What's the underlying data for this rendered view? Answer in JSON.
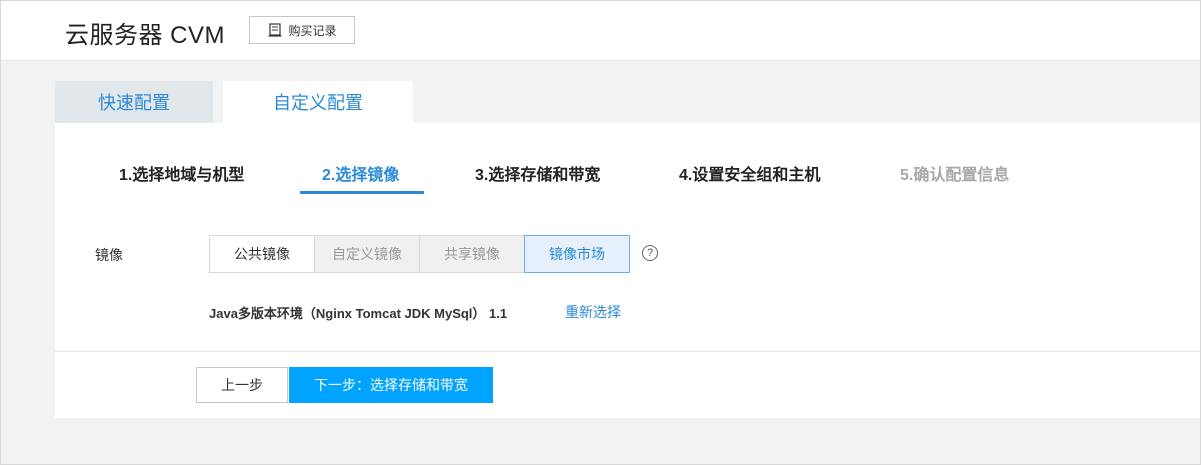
{
  "header": {
    "title": "云服务器 CVM",
    "purchase_record_label": "购买记录",
    "purchase_icon": "receipt-icon"
  },
  "tabs": [
    {
      "label": "快速配置",
      "active": false
    },
    {
      "label": "自定义配置",
      "active": true
    }
  ],
  "steps": [
    {
      "label": "1.选择地域与机型",
      "state": "done"
    },
    {
      "label": "2.选择镜像",
      "state": "active"
    },
    {
      "label": "3.选择存储和带宽",
      "state": "todo"
    },
    {
      "label": "4.设置安全组和主机",
      "state": "todo"
    },
    {
      "label": "5.确认配置信息",
      "state": "disabled"
    }
  ],
  "image_section": {
    "label": "镜像",
    "options": [
      {
        "label": "公共镜像",
        "state": "normal"
      },
      {
        "label": "自定义镜像",
        "state": "disabled"
      },
      {
        "label": "共享镜像",
        "state": "disabled"
      },
      {
        "label": "镜像市场",
        "state": "selected"
      }
    ],
    "help_icon": "help-circle-icon",
    "help_glyph": "?",
    "selected_image": "Java多版本环境（Nginx Tomcat JDK MySql） 1.1",
    "reselect_label": "重新选择"
  },
  "footer": {
    "prev_label": "上一步",
    "next_label": "下一步：选择存储和带宽"
  },
  "colors": {
    "accent": "#2b8ad8",
    "primary_button": "#00a4ff",
    "disabled_text": "#a8a8a8"
  }
}
